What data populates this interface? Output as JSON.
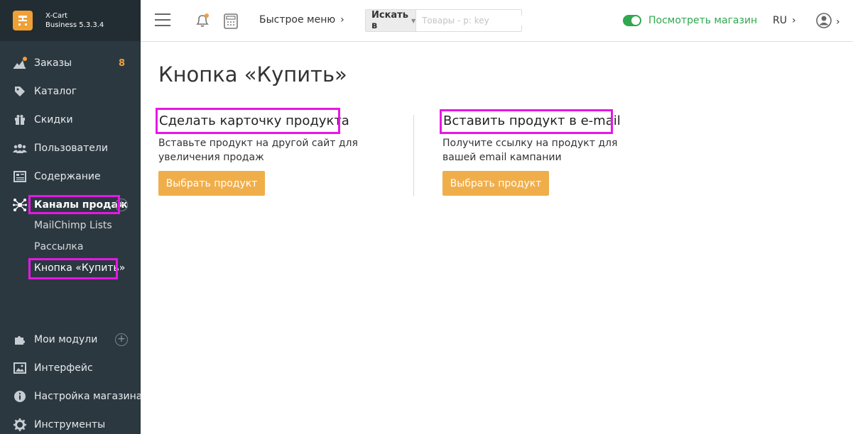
{
  "brand": {
    "name": "X-Cart",
    "version": "Business 5.3.3.4"
  },
  "sidebar": {
    "items": [
      {
        "label": "Заказы",
        "badge": "8"
      },
      {
        "label": "Каталог"
      },
      {
        "label": "Скидки"
      },
      {
        "label": "Пользователи"
      },
      {
        "label": "Содержание"
      },
      {
        "label": "Каналы продаж"
      },
      {
        "label": "Мои модули"
      },
      {
        "label": "Интерфейс"
      },
      {
        "label": "Настройка магазина"
      },
      {
        "label": "Инструменты"
      }
    ],
    "subitems": [
      "MailChimp Lists",
      "Рассылка",
      "Кнопка «Купить»"
    ]
  },
  "topbar": {
    "quick_menu": "Быстрое меню",
    "search_in": "Искать в",
    "search_placeholder": "Товары - p: key",
    "view_store": "Посмотреть магазин",
    "lang": "RU"
  },
  "main": {
    "title": "Кнопка «Купить»",
    "columns": [
      {
        "title": "Сделать карточку продукта",
        "desc": "Вставьте продукт на другой сайт для увеличения продаж",
        "button": "Выбрать продукт"
      },
      {
        "title": "Вставить продукт в e-mail",
        "desc": "Получите ссылку на продукт для вашей email кампании",
        "button": "Выбрать продукт"
      }
    ]
  },
  "colors": {
    "sidebar_bg": "#2c3840",
    "accent_orange": "#f0ae4b",
    "toggle_green": "#2fa84f",
    "highlight": "#e617e6"
  }
}
